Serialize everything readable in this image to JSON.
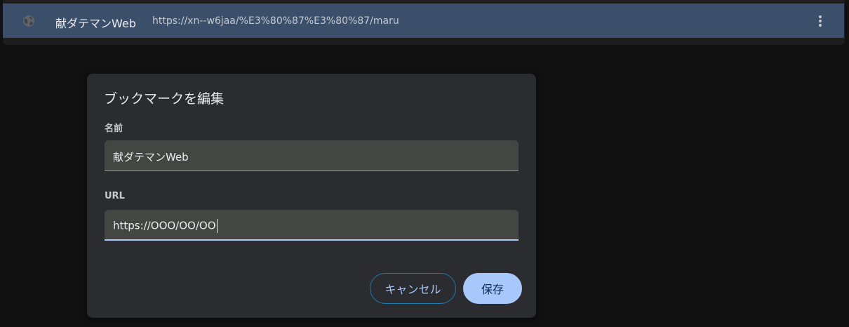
{
  "bookmark_row": {
    "title": "献ダテマンWeb",
    "url": "https://xn--w6jaa/%E3%80%87%E3%80%87/maru",
    "favicon": "globe-icon",
    "menu_icon": "more-vertical-icon"
  },
  "dialog": {
    "title": "ブックマークを編集",
    "name_label": "名前",
    "name_value": "献ダテマンWeb",
    "url_label": "URL",
    "url_value": "https://OOO/OO/OO",
    "cancel_label": "キャンセル",
    "save_label": "保存"
  },
  "colors": {
    "row_highlight": "#3b4f6b",
    "dialog_bg": "#2b2c30",
    "field_bg": "#444644",
    "accent": "#a8c7fa",
    "cancel_border": "#1a7bb0"
  }
}
